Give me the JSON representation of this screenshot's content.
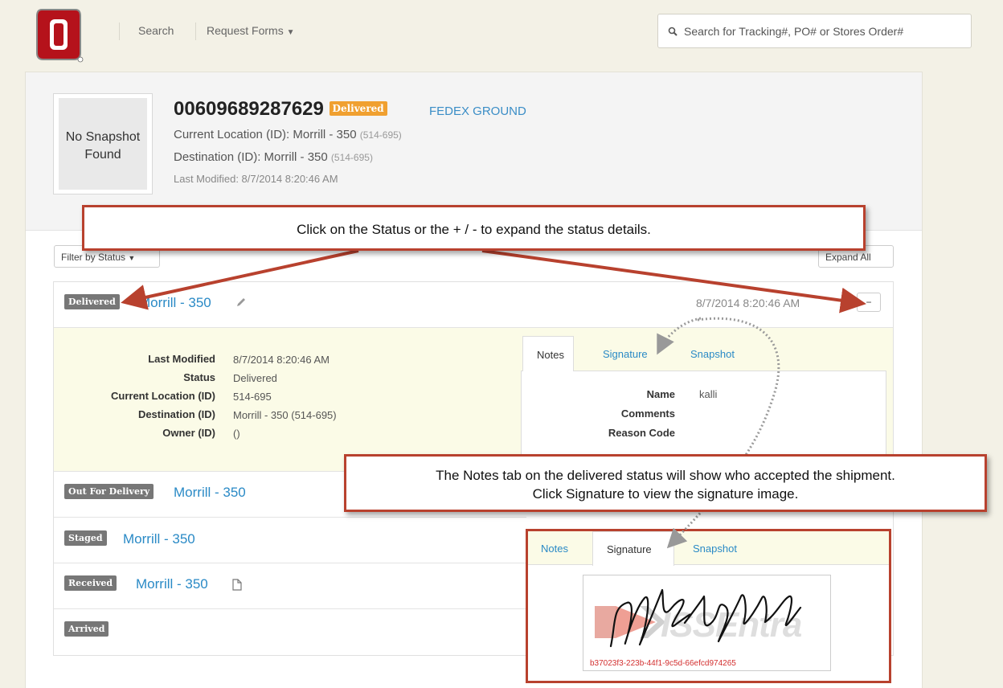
{
  "nav": {
    "search_label": "Search",
    "request_forms_label": "Request Forms",
    "search_placeholder": "Search for Tracking#, PO# or Stores Order#"
  },
  "header": {
    "snapshot_placeholder_line1": "No Snapshot",
    "snapshot_placeholder_line2": "Found",
    "tracking_number": "00609689287629",
    "status_badge": "Delivered",
    "carrier": "FEDEX GROUND",
    "current_location_label": "Current Location (ID):",
    "current_location_value": "Morrill - 350",
    "current_location_id": "(514-695)",
    "destination_label": "Destination (ID):",
    "destination_value": "Morrill - 350",
    "destination_id": "(514-695)",
    "last_modified": "Last Modified: 8/7/2014 8:20:46 AM"
  },
  "toolbar": {
    "filter_label": "Filter by Status",
    "expand_all_label": "Expand All"
  },
  "callouts": {
    "top": "Click on the Status or the + / - to expand the status details.",
    "middle_line1": "The Notes tab on the delivered status will show who accepted the shipment.",
    "middle_line2": "Click Signature to view the signature image."
  },
  "statuses": [
    {
      "badge": "Delivered",
      "location": "Morrill - 350",
      "timestamp": "8/7/2014 8:20:46 AM",
      "toggle": "−"
    },
    {
      "badge": "Out For Delivery",
      "location": "Morrill - 350"
    },
    {
      "badge": "Staged",
      "location": "Morrill - 350"
    },
    {
      "badge": "Received",
      "location": "Morrill - 350"
    },
    {
      "badge": "Arrived",
      "location": ""
    }
  ],
  "details": {
    "last_modified_label": "Last Modified",
    "last_modified_value": "8/7/2014 8:20:46 AM",
    "status_label": "Status",
    "status_value": "Delivered",
    "current_location_label": "Current Location (ID)",
    "current_location_value": "514-695",
    "destination_label": "Destination (ID)",
    "destination_value": "Morrill - 350 (514-695)",
    "owner_label": "Owner (ID)",
    "owner_value": "()"
  },
  "tabs": {
    "notes": "Notes",
    "signature": "Signature",
    "snapshot": "Snapshot"
  },
  "notes_fields": {
    "name_label": "Name",
    "name_value": "kalli",
    "comments_label": "Comments",
    "reason_code_label": "Reason Code"
  },
  "signature": {
    "watermark": "ISSEntra",
    "id": "b37023f3-223b-44f1-9c5d-66efcd974265"
  },
  "colors": {
    "callout_border": "#b8412e",
    "link_blue": "#2a8ac6",
    "delivered_orange": "#f0a030",
    "detail_bg": "#fbfbe7"
  }
}
